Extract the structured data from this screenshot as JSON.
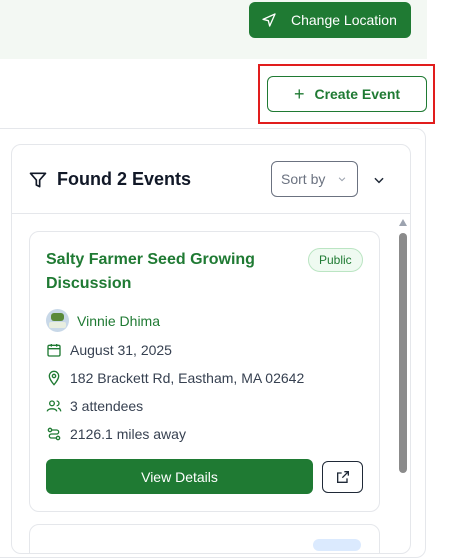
{
  "header": {
    "change_location_label": "Change Location",
    "create_event_label": "Create Event"
  },
  "events_panel": {
    "found_title": "Found 2 Events",
    "sort_placeholder": "Sort by"
  },
  "events": [
    {
      "title": "Salty Farmer Seed Growing Discussion",
      "visibility": "Public",
      "host": "Vinnie Dhima",
      "date": "August 31, 2025",
      "address": "182 Brackett Rd, Eastham, MA 02642",
      "attendees": "3 attendees",
      "distance": "2126.1 miles away",
      "view_label": "View Details"
    }
  ],
  "colors": {
    "brand_green": "#1f7a33",
    "highlight_red": "#e11d1d"
  },
  "icons": [
    "navigation-arrow-icon",
    "plus-icon",
    "filter-icon",
    "chevron-down-icon",
    "calendar-icon",
    "map-pin-icon",
    "users-icon",
    "route-icon",
    "external-link-icon"
  ]
}
